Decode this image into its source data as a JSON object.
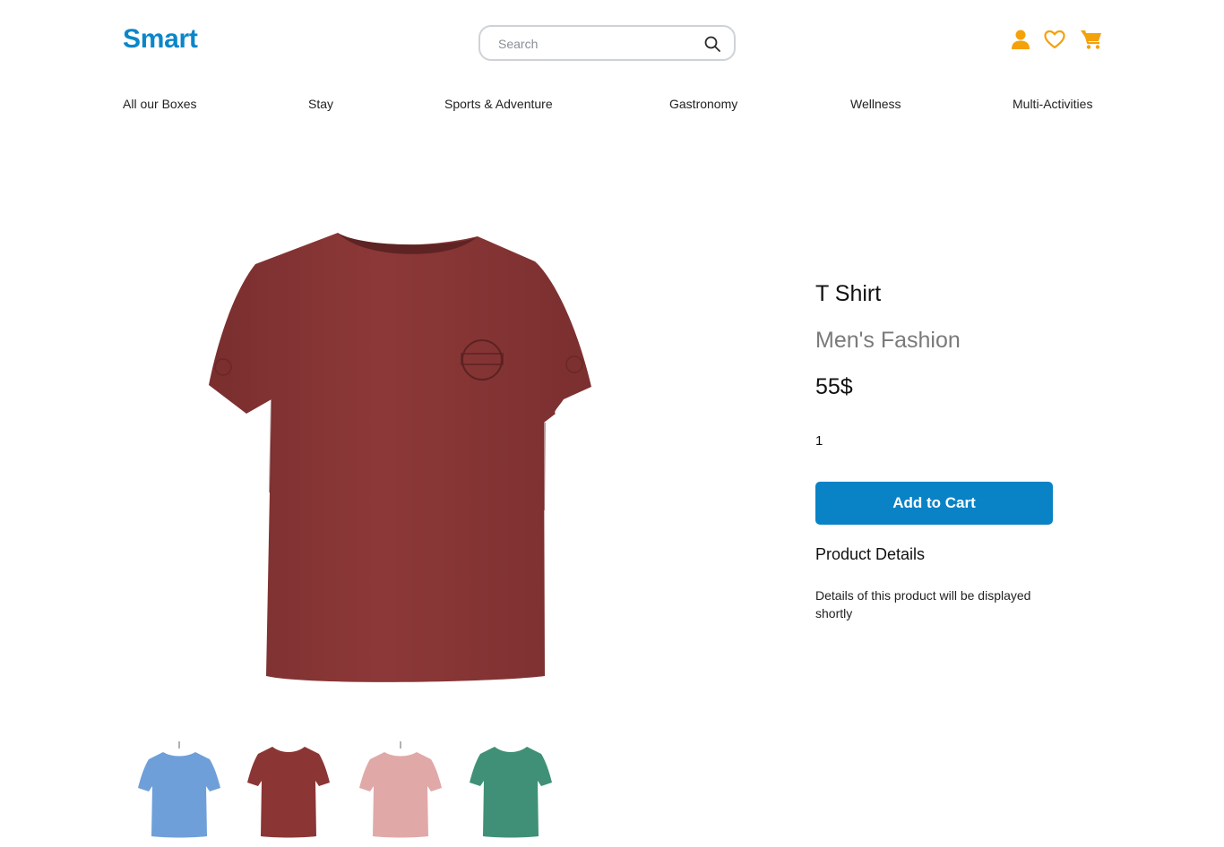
{
  "brand": {
    "name": "Smart",
    "color": "#0a86c9"
  },
  "search": {
    "placeholder": "Search",
    "value": "",
    "icon": "search-icon"
  },
  "header_icons": [
    {
      "name": "user-icon",
      "color": "#f5a10a"
    },
    {
      "name": "heart-icon",
      "color": "#f5a10a"
    },
    {
      "name": "cart-icon",
      "color": "#f5a10a"
    }
  ],
  "nav": {
    "items": [
      {
        "label": "All our Boxes"
      },
      {
        "label": "Stay"
      },
      {
        "label": "Sports & Adventure"
      },
      {
        "label": "Gastronomy"
      },
      {
        "label": "Wellness"
      },
      {
        "label": "Multi-Activities"
      }
    ]
  },
  "product": {
    "title": "T Shirt",
    "category": "Men's Fashion",
    "price": "55$",
    "quantity": "1",
    "add_to_cart_label": "Add to Cart",
    "details_heading": "Product Details",
    "details_text": "Details of this product will be displayed shortly",
    "main_image_color": "#8b3535",
    "variants": [
      {
        "name": "blue",
        "color": "#6f9fd8"
      },
      {
        "name": "maroon",
        "color": "#8b3535"
      },
      {
        "name": "pink",
        "color": "#e0a9a8"
      },
      {
        "name": "green",
        "color": "#3f9077"
      }
    ]
  },
  "colors": {
    "accent": "#0a82c6",
    "icon": "#f5a10a",
    "muted_text": "#7a7a7a"
  }
}
